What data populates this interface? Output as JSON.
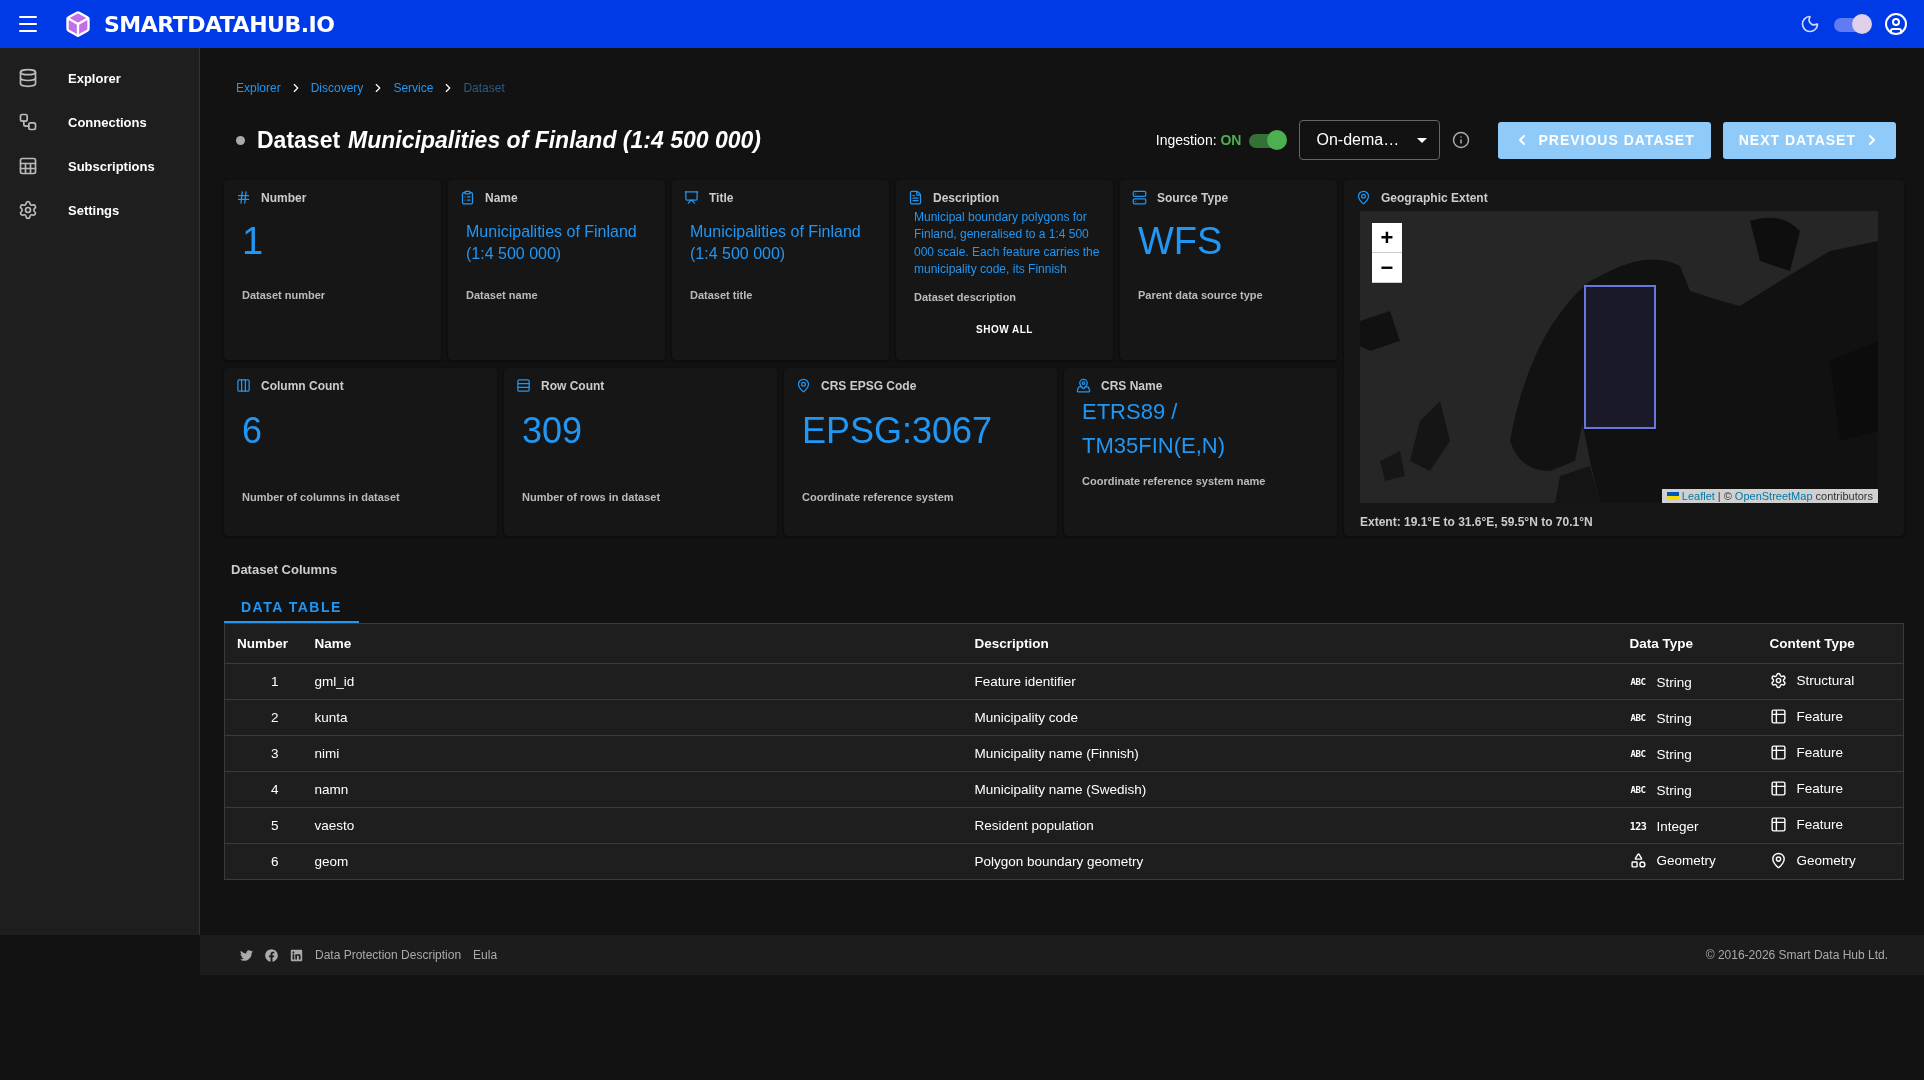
{
  "header": {
    "brand": "SMARTDATAHUB.IO",
    "theme_toggle_on": true
  },
  "sidebar": {
    "items": [
      {
        "label": "Explorer",
        "kind": "explorer"
      },
      {
        "label": "Connections",
        "kind": "connections"
      },
      {
        "label": "Subscriptions",
        "kind": "subscriptions"
      },
      {
        "label": "Settings",
        "kind": "settings"
      }
    ]
  },
  "breadcrumbs": [
    {
      "label": "Explorer",
      "current": false
    },
    {
      "label": "Discovery",
      "current": false
    },
    {
      "label": "Service",
      "current": false
    },
    {
      "label": "Dataset",
      "current": true
    }
  ],
  "title": {
    "prefix": "Dataset",
    "name": "Municipalities of Finland (1:4 500 000)"
  },
  "ingestion": {
    "label": "Ingestion:",
    "status": "ON",
    "on": true
  },
  "mode_select": {
    "value": "On-dema…"
  },
  "nav_buttons": [
    {
      "label": "PREVIOUS DATASET",
      "kind": "previous"
    },
    {
      "label": "NEXT DATASET",
      "kind": "next"
    }
  ],
  "cards_top": [
    {
      "kind": "number",
      "label": "Number",
      "value": "1",
      "caption": "Dataset number"
    },
    {
      "kind": "name",
      "label": "Name",
      "value": "Municipalities of Finland (1:4 500 000)",
      "caption": "Dataset name"
    },
    {
      "kind": "title",
      "label": "Title",
      "value": "Municipalities of Finland (1:4 500 000)",
      "caption": "Dataset title"
    },
    {
      "kind": "description",
      "label": "Description",
      "value": "Municipal boundary polygons for Finland, generalised to a 1:4 500 000 scale. Each feature carries the municipality code, its Finnish",
      "caption": "Dataset description",
      "action": "SHOW ALL"
    },
    {
      "kind": "source",
      "label": "Source Type",
      "value": "WFS",
      "caption": "Parent data source type"
    }
  ],
  "cards_bottom": [
    {
      "kind": "columns",
      "label": "Column Count",
      "value": "6",
      "caption": "Number of columns in dataset"
    },
    {
      "kind": "rows",
      "label": "Row Count",
      "value": "309",
      "caption": "Number of rows in dataset"
    },
    {
      "kind": "crs",
      "label": "CRS EPSG Code",
      "value": "EPSG:3067",
      "caption": "Coordinate reference system"
    },
    {
      "kind": "crsname",
      "label": "CRS Name",
      "value": "ETRS89 / TM35FIN(E,N)",
      "caption": "Coordinate reference system name"
    }
  ],
  "geo": {
    "label": "Geographic Extent",
    "zoom_in": "+",
    "zoom_out": "−",
    "attribution": {
      "leaflet": "Leaflet",
      "sep": "| ©",
      "osm": "OpenStreetMap",
      "rest": "contributors"
    },
    "extent": "Extent: 19.1°E to 31.6°E, 59.5°N to 70.1°N"
  },
  "columns_section": {
    "title": "Dataset Columns",
    "tabs": [
      {
        "label": "DATA TABLE",
        "selected": true
      }
    ],
    "table": {
      "columns": [
        "Number",
        "Name",
        "Description",
        "Data Type",
        "Content Type"
      ],
      "rows": [
        {
          "number": "1",
          "name": "gml_id",
          "description": "Feature identifier",
          "data_type": {
            "kind": "string",
            "badge": "ABC",
            "label": "String"
          },
          "content_type": {
            "kind": "structural",
            "label": "Structural"
          }
        },
        {
          "number": "2",
          "name": "kunta",
          "description": "Municipality code",
          "data_type": {
            "kind": "string",
            "badge": "ABC",
            "label": "String"
          },
          "content_type": {
            "kind": "feature",
            "label": "Feature"
          }
        },
        {
          "number": "3",
          "name": "nimi",
          "description": "Municipality name (Finnish)",
          "data_type": {
            "kind": "string",
            "badge": "ABC",
            "label": "String"
          },
          "content_type": {
            "kind": "feature",
            "label": "Feature"
          }
        },
        {
          "number": "4",
          "name": "namn",
          "description": "Municipality name (Swedish)",
          "data_type": {
            "kind": "string",
            "badge": "ABC",
            "label": "String"
          },
          "content_type": {
            "kind": "feature",
            "label": "Feature"
          }
        },
        {
          "number": "5",
          "name": "vaesto",
          "description": "Resident population",
          "data_type": {
            "kind": "integer",
            "badge": "123",
            "label": "Integer"
          },
          "content_type": {
            "kind": "feature",
            "label": "Feature"
          }
        },
        {
          "number": "6",
          "name": "geom",
          "description": "Polygon boundary geometry",
          "data_type": {
            "kind": "geometry",
            "label": "Geometry"
          },
          "content_type": {
            "kind": "geometry",
            "label": "Geometry"
          }
        }
      ]
    }
  },
  "footer": {
    "links": [
      "Data Protection Description",
      "Eula"
    ],
    "copyright": "© 2016-2026 Smart Data Hub Ltd."
  }
}
